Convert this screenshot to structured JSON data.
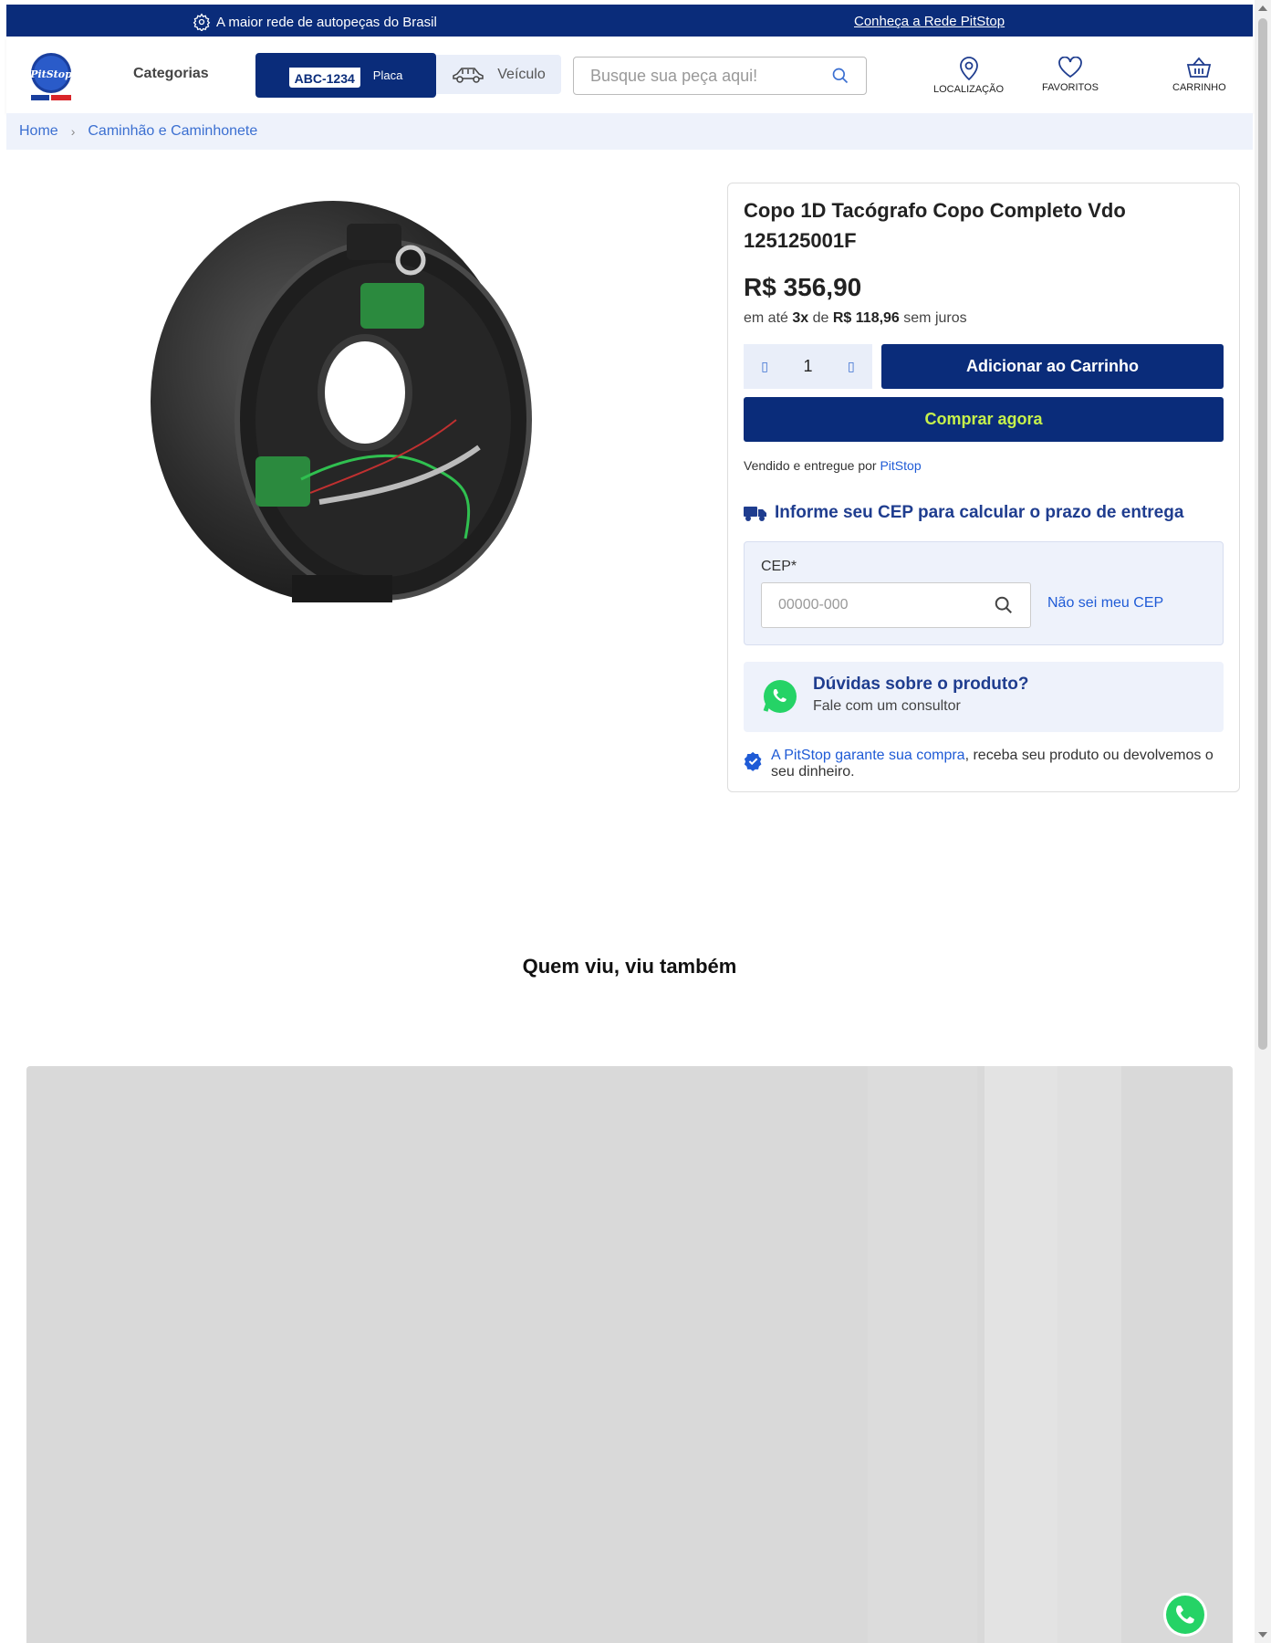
{
  "topbar": {
    "tagline": "A maior rede de autopeças do Brasil",
    "network_link": "Conheça a Rede PitStop"
  },
  "header": {
    "logo_icon": "pitstop-logo",
    "categories_label": "Categorias",
    "plate_example": "ABC-1234",
    "plate_label": "Placa",
    "vehicle_label": "Veículo",
    "search_placeholder": "Busque sua peça aqui!",
    "location_label": "LOCALIZAÇÃO",
    "favorites_label": "FAVORITOS",
    "cart_label": "CARRINHO"
  },
  "breadcrumb": {
    "items": [
      "Home",
      "Caminhão e Caminhonete"
    ],
    "separator": "›"
  },
  "product": {
    "title": "Copo 1D Tacógrafo Copo Completo Vdo 125125001F",
    "price": "R$ 356,90",
    "installments_prefix": "em até",
    "installments_count": "3x",
    "installments_mid": "de",
    "installments_value": "R$ 118,96",
    "installments_suffix": "sem juros",
    "quantity": "1",
    "add_to_cart": "Adicionar ao Carrinho",
    "buy_now": "Comprar agora",
    "seller_prefix": "Vendido e entregue por",
    "seller_name": "PitStop"
  },
  "shipping": {
    "title": "Informe seu CEP para calcular o prazo de entrega",
    "cep_label": "CEP*",
    "cep_placeholder": "00000-000",
    "dont_know": "Não sei meu CEP"
  },
  "help": {
    "title": "Dúvidas sobre o produto?",
    "subtitle": "Fale com um consultor"
  },
  "guarantee": {
    "highlight": "A PitStop garante sua compra",
    "text": ", receba seu produto ou devolvemos o seu dinheiro."
  },
  "related": {
    "title": "Quem viu, viu também"
  },
  "colors": {
    "brand_navy": "#0a2c7a",
    "accent_lime": "#c6f14b",
    "link_blue": "#1f5bd6",
    "whatsapp_green": "#25d366"
  }
}
